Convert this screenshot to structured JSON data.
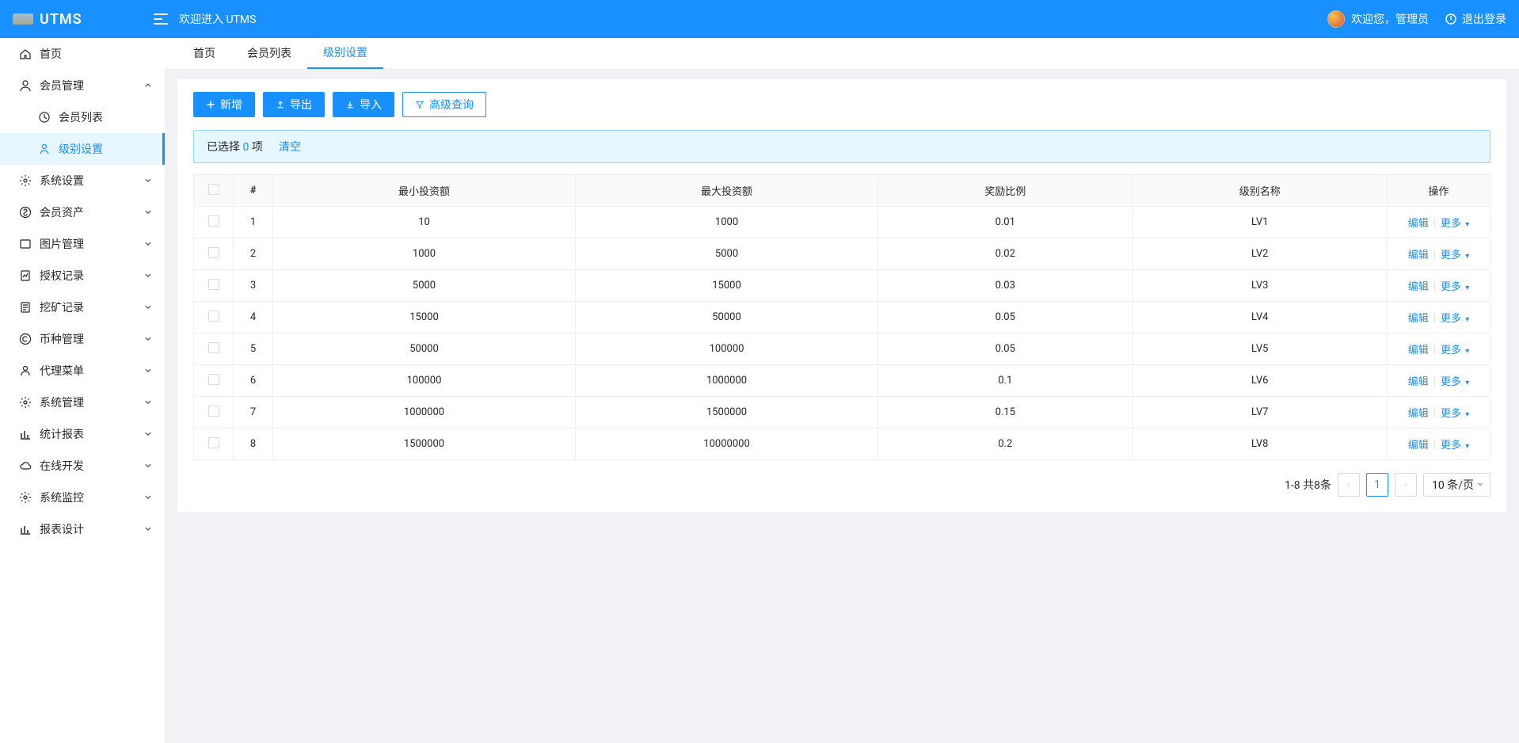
{
  "header": {
    "app_name": "UTMS",
    "welcome": "欢迎进入 UTMS",
    "user_greeting": "欢迎您，管理员",
    "logout": "退出登录"
  },
  "sidebar": {
    "items": [
      {
        "key": "home",
        "label": "首页",
        "icon": "home",
        "hasChildren": false
      },
      {
        "key": "member",
        "label": "会员管理",
        "icon": "user",
        "hasChildren": true,
        "expanded": true,
        "children": [
          {
            "key": "member-list",
            "label": "会员列表",
            "icon": "clock"
          },
          {
            "key": "level-setting",
            "label": "级别设置",
            "icon": "user-line"
          }
        ]
      },
      {
        "key": "system-setting",
        "label": "系统设置",
        "icon": "gear",
        "hasChildren": true
      },
      {
        "key": "member-asset",
        "label": "会员资产",
        "icon": "money",
        "hasChildren": true
      },
      {
        "key": "picture",
        "label": "图片管理",
        "icon": "image",
        "hasChildren": true
      },
      {
        "key": "auth-record",
        "label": "授权记录",
        "icon": "doc-chart",
        "hasChildren": true
      },
      {
        "key": "mining-record",
        "label": "挖矿记录",
        "icon": "doc",
        "hasChildren": true
      },
      {
        "key": "coin",
        "label": "币种管理",
        "icon": "copyright",
        "hasChildren": true
      },
      {
        "key": "agent",
        "label": "代理菜单",
        "icon": "user-outline",
        "hasChildren": true
      },
      {
        "key": "system-mgmt",
        "label": "系统管理",
        "icon": "gear",
        "hasChildren": true
      },
      {
        "key": "report",
        "label": "统计报表",
        "icon": "bar-chart",
        "hasChildren": true
      },
      {
        "key": "online-dev",
        "label": "在线开发",
        "icon": "cloud",
        "hasChildren": true
      },
      {
        "key": "system-monitor",
        "label": "系统监控",
        "icon": "gear",
        "hasChildren": true
      },
      {
        "key": "report-design",
        "label": "报表设计",
        "icon": "bar-chart",
        "hasChildren": true
      }
    ],
    "active": "level-setting"
  },
  "tabs": [
    {
      "key": "home",
      "label": "首页"
    },
    {
      "key": "member-list",
      "label": "会员列表"
    },
    {
      "key": "level-setting",
      "label": "级别设置",
      "active": true
    }
  ],
  "toolbar": {
    "add": "新增",
    "export": "导出",
    "import": "导入",
    "advanced_search": "高级查询"
  },
  "alert": {
    "prefix": "已选择 ",
    "count": "0",
    "suffix": " 项",
    "clear": "清空"
  },
  "table": {
    "columns": {
      "index": "#",
      "min_invest": "最小投资额",
      "max_invest": "最大投资额",
      "reward_ratio": "奖励比例",
      "level_name": "级别名称",
      "action": "操作"
    },
    "actions": {
      "edit": "编辑",
      "more": "更多"
    },
    "rows": [
      {
        "idx": "1",
        "min": "10",
        "max": "1000",
        "ratio": "0.01",
        "name": "LV1"
      },
      {
        "idx": "2",
        "min": "1000",
        "max": "5000",
        "ratio": "0.02",
        "name": "LV2"
      },
      {
        "idx": "3",
        "min": "5000",
        "max": "15000",
        "ratio": "0.03",
        "name": "LV3"
      },
      {
        "idx": "4",
        "min": "15000",
        "max": "50000",
        "ratio": "0.05",
        "name": "LV4"
      },
      {
        "idx": "5",
        "min": "50000",
        "max": "100000",
        "ratio": "0.05",
        "name": "LV5"
      },
      {
        "idx": "6",
        "min": "100000",
        "max": "1000000",
        "ratio": "0.1",
        "name": "LV6"
      },
      {
        "idx": "7",
        "min": "1000000",
        "max": "1500000",
        "ratio": "0.15",
        "name": "LV7"
      },
      {
        "idx": "8",
        "min": "1500000",
        "max": "10000000",
        "ratio": "0.2",
        "name": "LV8"
      }
    ]
  },
  "pagination": {
    "summary": "1-8 共8条",
    "current": "1",
    "page_size": "10 条/页"
  }
}
